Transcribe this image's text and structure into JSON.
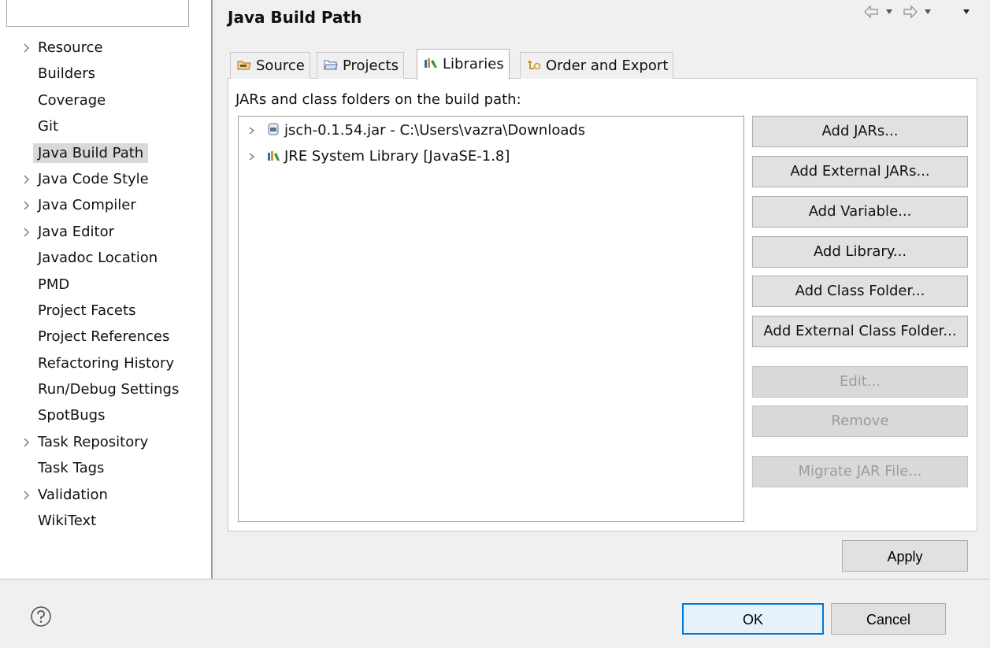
{
  "filter": {
    "value": ""
  },
  "nav": {
    "items": [
      {
        "label": "Resource",
        "expandable": true
      },
      {
        "label": "Builders",
        "expandable": false
      },
      {
        "label": "Coverage",
        "expandable": false
      },
      {
        "label": "Git",
        "expandable": false
      },
      {
        "label": "Java Build Path",
        "expandable": false,
        "selected": true
      },
      {
        "label": "Java Code Style",
        "expandable": true
      },
      {
        "label": "Java Compiler",
        "expandable": true
      },
      {
        "label": "Java Editor",
        "expandable": true
      },
      {
        "label": "Javadoc Location",
        "expandable": false
      },
      {
        "label": "PMD",
        "expandable": false
      },
      {
        "label": "Project Facets",
        "expandable": false
      },
      {
        "label": "Project References",
        "expandable": false
      },
      {
        "label": "Refactoring History",
        "expandable": false
      },
      {
        "label": "Run/Debug Settings",
        "expandable": false
      },
      {
        "label": "SpotBugs",
        "expandable": false
      },
      {
        "label": "Task Repository",
        "expandable": true
      },
      {
        "label": "Task Tags",
        "expandable": false
      },
      {
        "label": "Validation",
        "expandable": true
      },
      {
        "label": "WikiText",
        "expandable": false
      }
    ]
  },
  "page": {
    "title": "Java Build Path"
  },
  "tabs": [
    {
      "label": "Source",
      "icon": "source-folder-icon"
    },
    {
      "label": "Projects",
      "icon": "projects-folder-icon"
    },
    {
      "label": "Libraries",
      "icon": "libraries-icon",
      "active": true
    },
    {
      "label": "Order and Export",
      "icon": "order-export-icon"
    }
  ],
  "libraries": {
    "caption": "JARs and class folders on the build path:",
    "entries": [
      {
        "label": "jsch-0.1.54.jar - C:\\Users\\vazra\\Downloads",
        "icon": "jar-icon"
      },
      {
        "label": "JRE System Library [JavaSE-1.8]",
        "icon": "library-icon"
      }
    ]
  },
  "buttons": {
    "add_jars": "Add JARs...",
    "add_external_jars": "Add External JARs...",
    "add_variable": "Add Variable...",
    "add_library": "Add Library...",
    "add_class_folder": "Add Class Folder...",
    "add_external_class_folder": "Add External Class Folder...",
    "edit": "Edit...",
    "remove": "Remove",
    "migrate_jar": "Migrate JAR File...",
    "apply": "Apply",
    "ok": "OK",
    "cancel": "Cancel"
  },
  "colors": {
    "selection": "#d9d9d9",
    "focus_border": "#0078d7",
    "library_icon": "#2e6bb8",
    "tab_icon": "#c79a2c"
  }
}
